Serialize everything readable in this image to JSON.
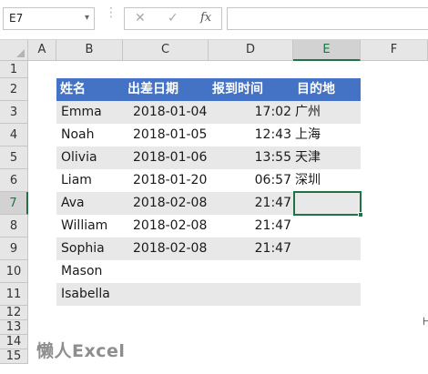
{
  "formula_bar": {
    "name_box": "E7",
    "name_box_arrow": "▾",
    "cancel_glyph": "✕",
    "enter_glyph": "✓",
    "fx_label": "fx",
    "formula": ""
  },
  "columns": [
    "A",
    "B",
    "C",
    "D",
    "E",
    "F"
  ],
  "rows": [
    "1",
    "2",
    "3",
    "4",
    "5",
    "6",
    "7",
    "8",
    "9",
    "10",
    "11",
    "12",
    "13",
    "14",
    "15"
  ],
  "table": {
    "headers": [
      "姓名",
      "出差日期",
      "报到时间",
      "目的地"
    ],
    "rows": [
      [
        "Emma",
        "2018-01-04",
        "17:02",
        "广州"
      ],
      [
        "Noah",
        "2018-01-05",
        "12:43",
        "上海"
      ],
      [
        "Olivia",
        "2018-01-06",
        "13:55",
        "天津"
      ],
      [
        "Liam",
        "2018-01-20",
        "06:57",
        "深圳"
      ],
      [
        "Ava",
        "2018-02-08",
        "21:47",
        ""
      ],
      [
        "William",
        "2018-02-08",
        "21:47",
        ""
      ],
      [
        "Sophia",
        "2018-02-08",
        "21:47",
        ""
      ],
      [
        "Mason",
        "",
        "",
        ""
      ],
      [
        "Isabella",
        "",
        "",
        ""
      ]
    ]
  },
  "selected_cell": "E7",
  "watermark": "懒人Excel",
  "colors": {
    "header_blue": "#4472c4",
    "band_gray": "#e8e8e8",
    "excel_green": "#217346"
  }
}
